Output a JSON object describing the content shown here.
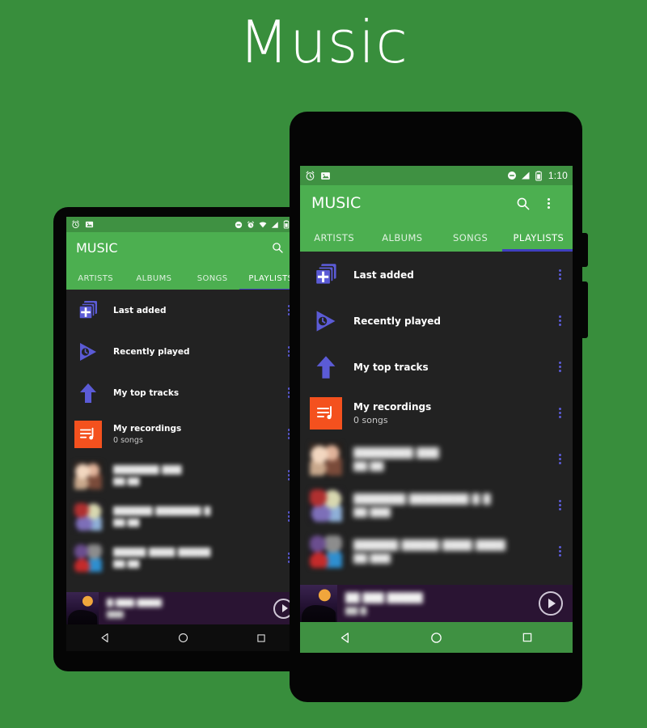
{
  "hero": {
    "title": "Music"
  },
  "colors": {
    "background_green": "#388E3C",
    "toolbar_green": "#4CAF50",
    "accent_purple": "#5b5bd6",
    "tab_indicator": "#3f3fbf",
    "recordings_orange": "#F4511E",
    "list_background": "#222222",
    "nowplaying_background": "#2a1433"
  },
  "front_phone": {
    "statusbar": {
      "left_icons": [
        "alarm-clock-icon",
        "image-icon"
      ],
      "right_icons": [
        "do-not-disturb-icon",
        "signal-icon",
        "battery-icon"
      ],
      "clock": "1:10"
    },
    "toolbar": {
      "app_title": "MUSIC",
      "search_label": "search-icon",
      "overflow_label": "overflow-menu-icon"
    },
    "tabs": [
      {
        "label": "ARTISTS",
        "active": false
      },
      {
        "label": "ALBUMS",
        "active": false
      },
      {
        "label": "SONGS",
        "active": false
      },
      {
        "label": "PLAYLISTS",
        "active": true
      }
    ],
    "playlists": [
      {
        "title": "Last added",
        "subtitle": "",
        "icon": "stacked-playlist-add-icon",
        "thumb": "icon-purple"
      },
      {
        "title": "Recently played",
        "subtitle": "",
        "icon": "play-clock-icon",
        "thumb": "icon-purple"
      },
      {
        "title": "My top tracks",
        "subtitle": "",
        "icon": "up-arrow-icon",
        "thumb": "icon-purple"
      },
      {
        "title": "My recordings",
        "subtitle": "0 songs",
        "icon": "playlist-music-icon",
        "thumb": "orange"
      },
      {
        "title": "████████ ███",
        "subtitle": "██ ██",
        "icon": "album-art",
        "thumb": "art-a"
      },
      {
        "title": "███████ ████████ █ █",
        "subtitle": "██ ███",
        "icon": "album-art",
        "thumb": "art-b"
      },
      {
        "title": "██████ █████ ████ ████",
        "subtitle": "██ ███",
        "icon": "album-art",
        "thumb": "art-c"
      }
    ],
    "nowplaying": {
      "track_title": "██ ███ █████",
      "track_artist": "██ █",
      "play_label": "play-button"
    },
    "navbar": {
      "back": "back-nav-icon",
      "home": "home-nav-icon",
      "recents": "recents-nav-icon"
    }
  },
  "back_phone": {
    "statusbar": {
      "left_icons": [
        "alarm-clock-icon",
        "image-icon"
      ],
      "right_icons": [
        "do-not-disturb-icon",
        "alarm-icon",
        "wifi-icon",
        "signal-icon",
        "battery-icon"
      ],
      "clock": ""
    },
    "toolbar": {
      "app_title": "MUSIC",
      "search_label": "search-icon"
    },
    "tabs": [
      {
        "label": "ARTISTS",
        "active": false
      },
      {
        "label": "ALBUMS",
        "active": false
      },
      {
        "label": "SONGS",
        "active": false
      },
      {
        "label": "PLAYLISTS",
        "active": true
      }
    ],
    "playlists": [
      {
        "title": "Last added",
        "subtitle": "",
        "icon": "stacked-playlist-add-icon",
        "thumb": "icon-purple"
      },
      {
        "title": "Recently played",
        "subtitle": "",
        "icon": "play-clock-icon",
        "thumb": "icon-purple"
      },
      {
        "title": "My top tracks",
        "subtitle": "",
        "icon": "up-arrow-icon",
        "thumb": "icon-purple"
      },
      {
        "title": "My recordings",
        "subtitle": "0 songs",
        "icon": "playlist-music-icon",
        "thumb": "orange"
      },
      {
        "title": "███████ ███",
        "subtitle": "██ ██",
        "icon": "album-art",
        "thumb": "art-a"
      },
      {
        "title": "██████ ███████ █",
        "subtitle": "██ ██",
        "icon": "album-art",
        "thumb": "art-b"
      },
      {
        "title": "█████ ████ █████",
        "subtitle": "██ ██",
        "icon": "album-art",
        "thumb": "art-c"
      }
    ],
    "nowplaying": {
      "track_title": "█ ███ ████",
      "track_artist": "███",
      "play_label": "play-button"
    },
    "navbar": {
      "back": "back-nav-icon",
      "home": "home-nav-icon",
      "recents": "recents-nav-icon"
    }
  }
}
